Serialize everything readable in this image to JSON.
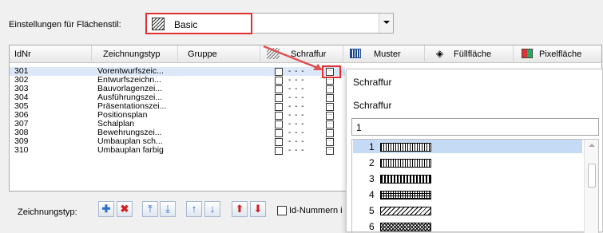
{
  "settings": {
    "label": "Einstellungen für Flächenstil:",
    "selected_style": "Basic"
  },
  "columns": {
    "idnr": "IdNr",
    "zeichnungstyp": "Zeichnungstyp",
    "gruppe": "Gruppe",
    "schraffur": "Schraffur",
    "muster": "Muster",
    "fuellflaeche": "Füllfläche",
    "pixelflaeche": "Pixelfläche"
  },
  "rows": [
    {
      "id": "301",
      "typ": "Vorentwurfszeic..."
    },
    {
      "id": "302",
      "typ": "Entwurfszeichn..."
    },
    {
      "id": "303",
      "typ": "Bauvorlagenzei..."
    },
    {
      "id": "304",
      "typ": "Ausführungszei..."
    },
    {
      "id": "305",
      "typ": "Präsentationszei..."
    },
    {
      "id": "306",
      "typ": "Positionsplan"
    },
    {
      "id": "307",
      "typ": "Schalplan"
    },
    {
      "id": "308",
      "typ": "Bewehrungszei..."
    },
    {
      "id": "309",
      "typ": "Umbauplan sch..."
    },
    {
      "id": "310",
      "typ": "Umbauplan farbig"
    }
  ],
  "row_dash": "- - -",
  "popup": {
    "title": "Schraffur",
    "subtitle": "Schraffur",
    "input_value": "1",
    "items": [
      "1",
      "2",
      "3",
      "4",
      "5",
      "6"
    ]
  },
  "toolbar": {
    "label": "Zeichnungstyp:",
    "idnum_label": "Id-Nummern i"
  },
  "colors": {
    "highlight": "#e03030",
    "selection": "#c5daf5"
  }
}
